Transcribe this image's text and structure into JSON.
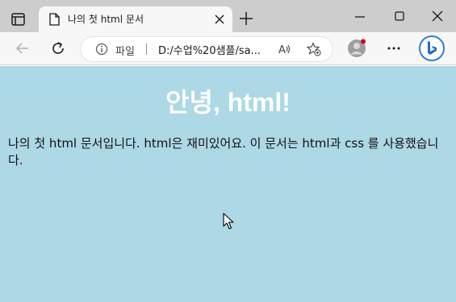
{
  "browser": {
    "tab": {
      "title": "나의 첫 html 문서"
    },
    "address_bar": {
      "site_label": "파일",
      "url": "D:/수업%20샘플/sa..."
    }
  },
  "page": {
    "heading": "안녕, html!",
    "paragraph": "나의 첫 html 문서입니다. html은 재미있어요. 이 문서는 html과 css 를 사용했습니다.",
    "background_color": "#add8e6",
    "heading_color": "#ffffff"
  },
  "icons": {
    "tab_actions": "tab-actions-icon",
    "page": "page-icon",
    "close": "close-icon",
    "new_tab": "plus-icon",
    "minimize": "minimize-icon",
    "maximize": "maximize-icon",
    "window_close": "window-close-icon",
    "back": "back-arrow-icon",
    "refresh": "refresh-icon",
    "info": "info-icon",
    "read_aloud": "read-aloud-icon",
    "add_favorite": "add-favorite-icon",
    "profile": "profile-icon",
    "more": "more-icon",
    "copilot": "bing-copilot-icon",
    "cursor": "mouse-cursor-icon"
  }
}
